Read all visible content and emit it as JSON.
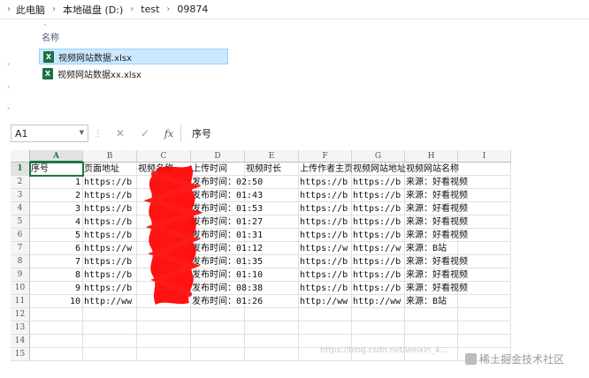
{
  "explorer": {
    "breadcrumb": [
      "此电脑",
      "本地磁盘 (D:)",
      "test",
      "09874"
    ],
    "column_header": "名称",
    "files": [
      {
        "name": "视频网站数据.xlsx",
        "selected": true
      },
      {
        "name": "视频网站数据xx.xlsx",
        "selected": false
      }
    ]
  },
  "excel": {
    "name_box": "A1",
    "formula_bar_value": "序号",
    "fx_label": "fx",
    "cancel_glyph": "✕",
    "enter_glyph": "✓",
    "columns": [
      "A",
      "B",
      "C",
      "D",
      "E",
      "F",
      "G",
      "H",
      "I"
    ],
    "row_numbers": [
      "1",
      "2",
      "3",
      "4",
      "5",
      "6",
      "7",
      "8",
      "9",
      "10",
      "11",
      "12",
      "13",
      "14",
      "15"
    ],
    "header_row": [
      "序号",
      "页面地址",
      "视频名称",
      "上传时间",
      "视频时长",
      "上传作者主页",
      "视频网站地址",
      "视频网站名称",
      ""
    ],
    "rows": [
      {
        "num": "1",
        "page": "https://b",
        "time": "发布时间：02:50",
        "author": "https://b",
        "site": "https://b",
        "source": "来源：好看视频"
      },
      {
        "num": "2",
        "page": "https://b",
        "time": "发布时间：01:43",
        "author": "https://b",
        "site": "https://b",
        "source": "来源：好看视频"
      },
      {
        "num": "3",
        "page": "https://b",
        "time": "发布时间：01:53",
        "author": "https://b",
        "site": "https://b",
        "source": "来源：好看视频"
      },
      {
        "num": "4",
        "page": "https://b",
        "time": "发布时间：01:27",
        "author": "https://b",
        "site": "https://b",
        "source": "来源：好看视频"
      },
      {
        "num": "5",
        "page": "https://b",
        "time": "发布时间：01:31",
        "author": "https://b",
        "site": "https://b",
        "source": "来源：好看视频"
      },
      {
        "num": "6",
        "page": "https://w",
        "time": "发布时间：01:12",
        "author": "https://w",
        "site": "https://w",
        "source": "来源：B站"
      },
      {
        "num": "7",
        "page": "https://b",
        "time": "发布时间：01:35",
        "author": "https://b",
        "site": "https://b",
        "source": "来源：好看视频"
      },
      {
        "num": "8",
        "page": "https://b",
        "time": "发布时间：01:10",
        "author": "https://b",
        "site": "https://b",
        "source": "来源：好看视频"
      },
      {
        "num": "9",
        "page": "https://b",
        "time": "发布时间：08:38",
        "author": "https://b",
        "site": "https://b",
        "source": "来源：好看视频"
      },
      {
        "num": "10",
        "page": "http://ww",
        "time": "发布时间：01:26",
        "author": "http://ww",
        "site": "http://ww",
        "source": "来源：B站"
      }
    ]
  },
  "watermark": {
    "url": "https://blog.csdn.net/weixin_4...",
    "brand": "稀土掘金技术社区"
  },
  "colors": {
    "excel_green": "#217346",
    "selection_blue": "#cce8ff",
    "scribble_red": "#ff0000"
  }
}
